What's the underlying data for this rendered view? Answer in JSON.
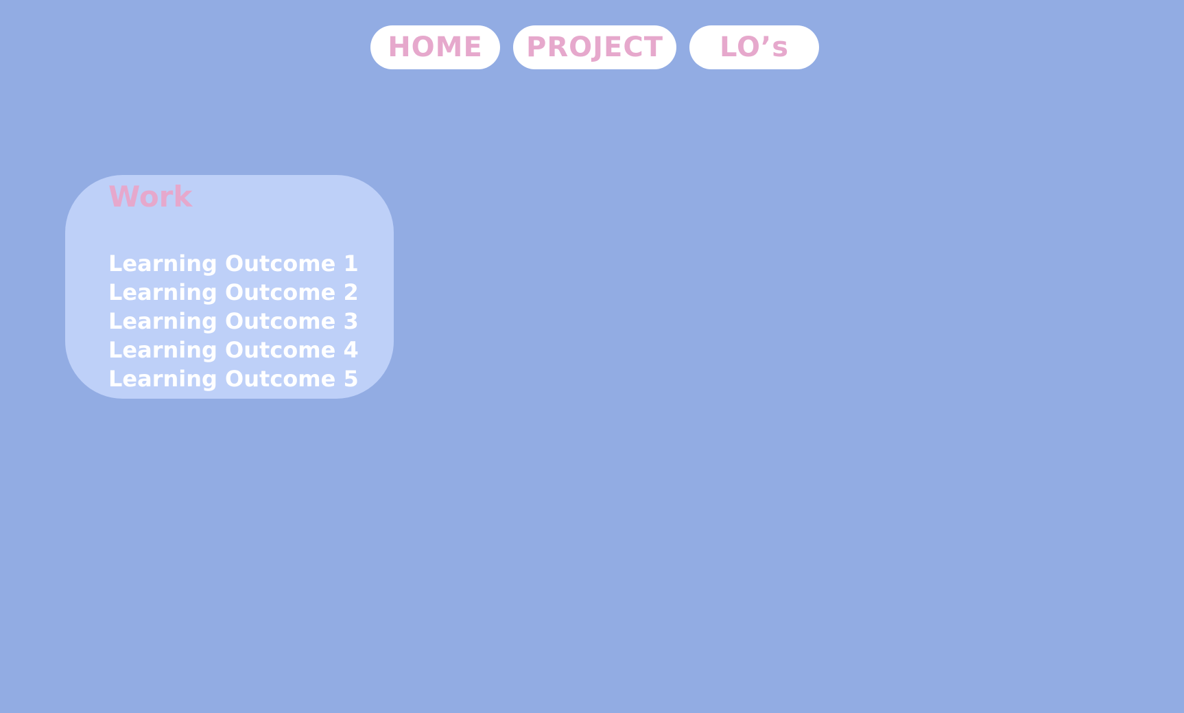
{
  "colors": {
    "background": "#92ace3",
    "card": "#bed0f8",
    "accent_pink": "#e6a8cc",
    "button_bg": "#ffffff",
    "text_white": "#ffffff"
  },
  "nav": {
    "items": [
      {
        "label": "HOME"
      },
      {
        "label": "PROJECT"
      },
      {
        "label": "LO’s"
      }
    ]
  },
  "work": {
    "title": "Work",
    "outcomes": [
      {
        "label": "Learning Outcome 1"
      },
      {
        "label": "Learning Outcome 2"
      },
      {
        "label": "Learning Outcome 3"
      },
      {
        "label": "Learning Outcome 4"
      },
      {
        "label": "Learning Outcome 5"
      }
    ]
  }
}
